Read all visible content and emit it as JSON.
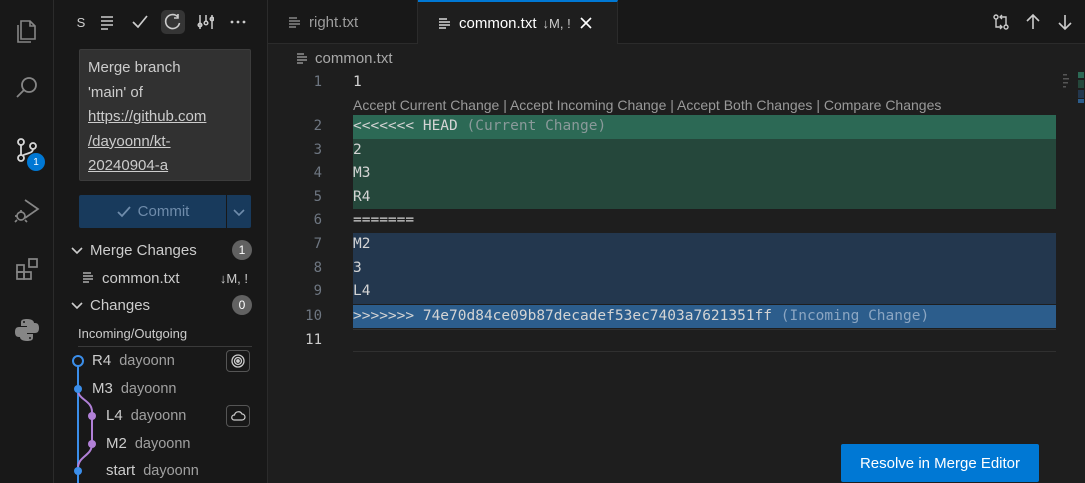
{
  "activity_bar": {
    "items": [
      {
        "icon": "explorer-icon"
      },
      {
        "icon": "search-icon"
      },
      {
        "icon": "source-control-icon",
        "badge": "1"
      },
      {
        "icon": "run-debug-icon"
      },
      {
        "icon": "extensions-icon"
      },
      {
        "icon": "python-icon"
      }
    ]
  },
  "sidebar": {
    "toolbar": {
      "s_label": "S",
      "icons": [
        "list-icon",
        "check-icon",
        "refresh-icon",
        "graph-icon",
        "more-icon"
      ]
    },
    "commit_message_lines": [
      "Merge branch",
      "'main' of",
      "https://github.com",
      "/dayoonn/kt-",
      "20240904-a"
    ],
    "commit_button_label": "Commit",
    "sections": {
      "merge_changes": {
        "label": "Merge Changes",
        "count": "1"
      },
      "changes": {
        "label": "Changes",
        "count": "0"
      }
    },
    "merge_file": {
      "name": "common.txt",
      "status": "↓M, !"
    },
    "incoming_outgoing_label": "Incoming/Outgoing",
    "graph": [
      {
        "message": "R4",
        "author": "dayoonn"
      },
      {
        "message": "M3",
        "author": "dayoonn"
      },
      {
        "message": "L4",
        "author": "dayoonn"
      },
      {
        "message": "M2",
        "author": "dayoonn"
      },
      {
        "message": "start",
        "author": "dayoonn"
      }
    ]
  },
  "tabs": [
    {
      "label": "right.txt",
      "active": false
    },
    {
      "label": "common.txt",
      "status": "↓M, !",
      "active": true
    }
  ],
  "breadcrumb": {
    "file": "common.txt"
  },
  "editor": {
    "codelens": "Accept Current Change | Accept Incoming Change | Accept Both Changes | Compare Changes",
    "lines": [
      {
        "num": "1",
        "text": "1"
      },
      {
        "num": "2",
        "text": "<<<<<<< HEAD",
        "suffix": "(Current Change)"
      },
      {
        "num": "3",
        "text": "2"
      },
      {
        "num": "4",
        "text": "M3"
      },
      {
        "num": "5",
        "text": "R4"
      },
      {
        "num": "6",
        "text": "======="
      },
      {
        "num": "7",
        "text": "M2"
      },
      {
        "num": "8",
        "text": "3"
      },
      {
        "num": "9",
        "text": "L4"
      },
      {
        "num": "10",
        "text": ">>>>>>> 74e70d84ce09b87decadef53ec7403a7621351ff",
        "suffix": "(Incoming Change)"
      },
      {
        "num": "11",
        "text": ""
      }
    ]
  },
  "resolve_button_label": "Resolve in Merge Editor",
  "colors": {
    "accent": "#0078d4",
    "current_header": "#2c6955",
    "current_body": "#25473b",
    "incoming_body": "#23374e",
    "incoming_header": "#2c5d8c",
    "graph_blue": "#3b8eea",
    "graph_purple": "#b180d7"
  }
}
